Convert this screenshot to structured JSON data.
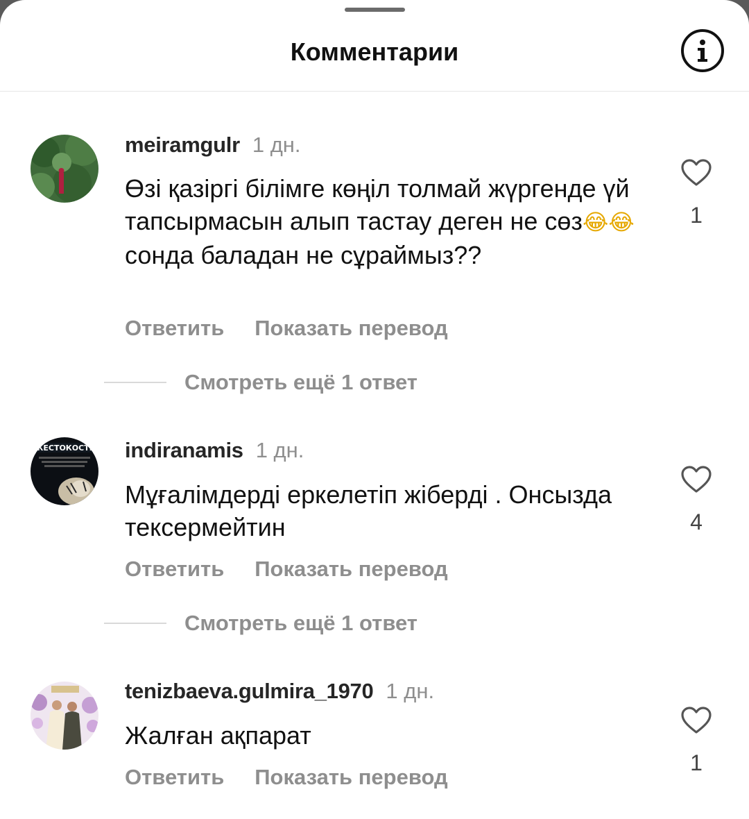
{
  "header": {
    "title": "Комментарии",
    "info_icon": "info-icon"
  },
  "comments": [
    {
      "username": "meiramgulr",
      "time": "1 дн.",
      "text_before": "Өзі қазіргі білімге көңіл толмай жүргенде үй тапсырмасын алып тастау деген не сөз",
      "emoji": "😂😂",
      "text_after": " сонда баладан не сұраймыз??",
      "reply_label": "Ответить",
      "translate_label": "Показать перевод",
      "likes": "1",
      "view_replies": "Смотреть ещё 1 ответ"
    },
    {
      "username": "indiranamis",
      "time": "1 дн.",
      "text": "Мұғалімдерді еркелетіп жіберді . Онсызда тексермейтин",
      "reply_label": "Ответить",
      "translate_label": "Показать перевод",
      "likes": "4",
      "view_replies": "Смотреть ещё 1 ответ",
      "avatar_caption": "ЖЕСТОКОСТЬ"
    },
    {
      "username": "tenizbaeva.gulmira_1970",
      "time": "1 дн.",
      "text": "Жалған ақпарат",
      "reply_label": "Ответить",
      "translate_label": "Показать перевод",
      "likes": "1"
    }
  ],
  "colors": {
    "accent_text": "#111111",
    "muted": "#8e8e8e",
    "divider": "#e6e6e6"
  }
}
